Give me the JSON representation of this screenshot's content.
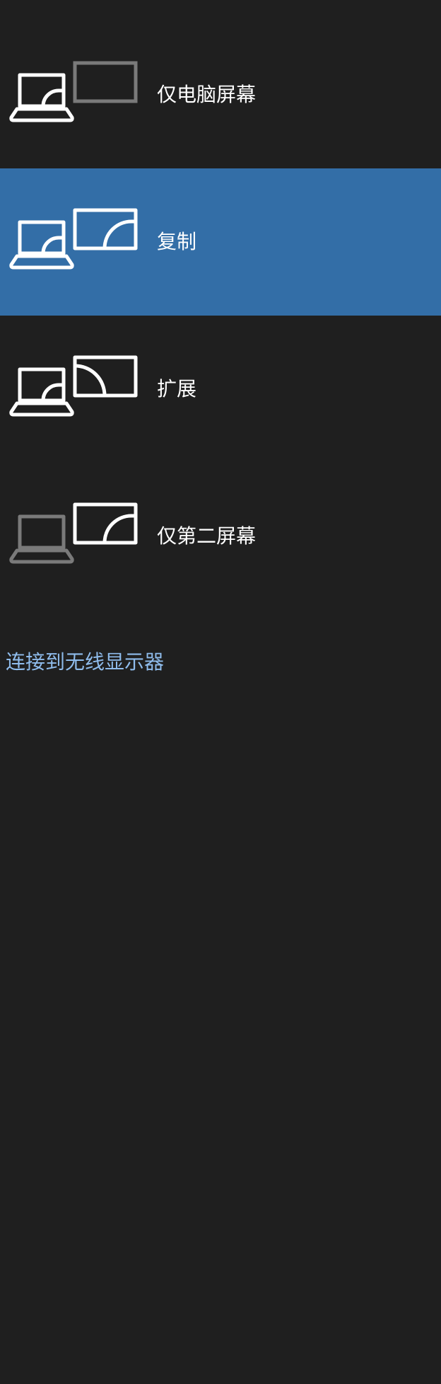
{
  "colors": {
    "background": "#1f1f1f",
    "selected_background": "#336ea7",
    "text": "#ffffff",
    "dimmed_icon": "#7a7a7a",
    "link": "#8fbcec"
  },
  "options": [
    {
      "label": "仅电脑屏幕",
      "icon": "pc-screen-only-icon",
      "selected": false
    },
    {
      "label": "复制",
      "icon": "duplicate-icon",
      "selected": true
    },
    {
      "label": "扩展",
      "icon": "extend-icon",
      "selected": false
    },
    {
      "label": "仅第二屏幕",
      "icon": "second-screen-only-icon",
      "selected": false
    }
  ],
  "wireless_link": {
    "label": "连接到无线显示器"
  }
}
